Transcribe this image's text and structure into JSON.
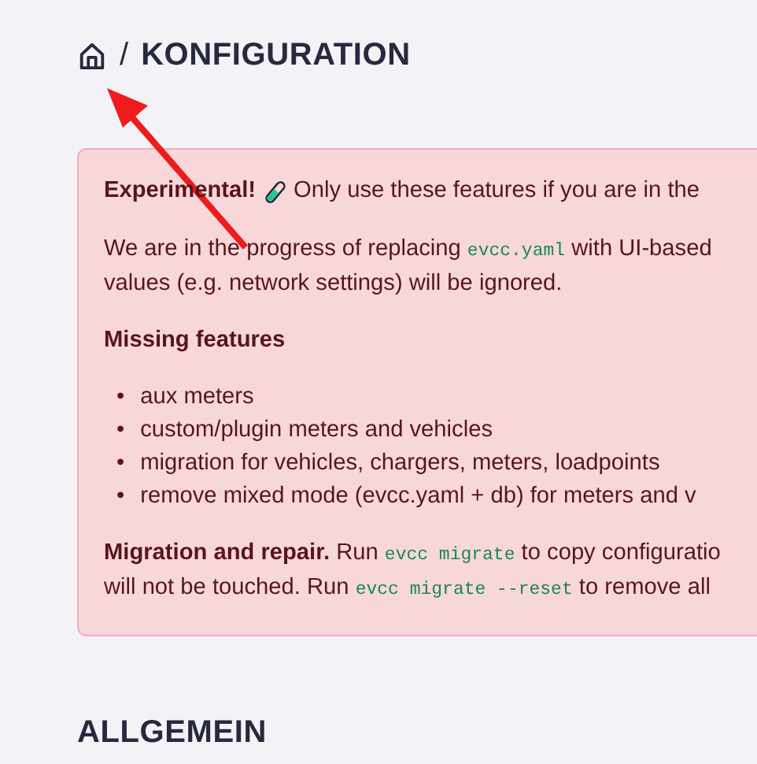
{
  "header": {
    "separator": "/",
    "title": "KONFIGURATION"
  },
  "alert": {
    "intro": {
      "label": "Experimental!",
      "text": "Only use these features if you are in the"
    },
    "paragraphs": [
      {
        "lines": [
          [
            {
              "kind": "text",
              "text": "We are in the progress of replacing "
            },
            {
              "kind": "code",
              "text": "evcc.yaml"
            },
            {
              "kind": "text",
              "text": " with UI-based"
            }
          ],
          [
            {
              "kind": "text",
              "text": "values (e.g. network settings) will be ignored."
            }
          ]
        ]
      }
    ],
    "missing": {
      "title": "Missing features",
      "items": [
        {
          "bullet": "•",
          "text": "aux meters"
        },
        {
          "bullet": "•",
          "text": "custom/plugin meters and vehicles"
        },
        {
          "bullet": "•",
          "text": "migration for vehicles, chargers, meters, loadpoints"
        },
        {
          "bullet": "•",
          "text": "remove mixed mode (evcc.yaml + db) for meters and v"
        }
      ]
    },
    "footer": {
      "lines": [
        [
          {
            "kind": "text",
            "text": "**Migration and repair.** Run "
          },
          {
            "kind": "code",
            "text": "evcc migrate"
          },
          {
            "kind": "text",
            "text": " to copy configuratio"
          }
        ],
        [
          {
            "kind": "text",
            "text": "will not be touched. Run "
          },
          {
            "kind": "code",
            "text": "evcc migrate --reset"
          },
          {
            "kind": "text",
            "text": " to remove all"
          }
        ]
      ]
    }
  },
  "section": {
    "title": "ALLGEMEIN"
  }
}
